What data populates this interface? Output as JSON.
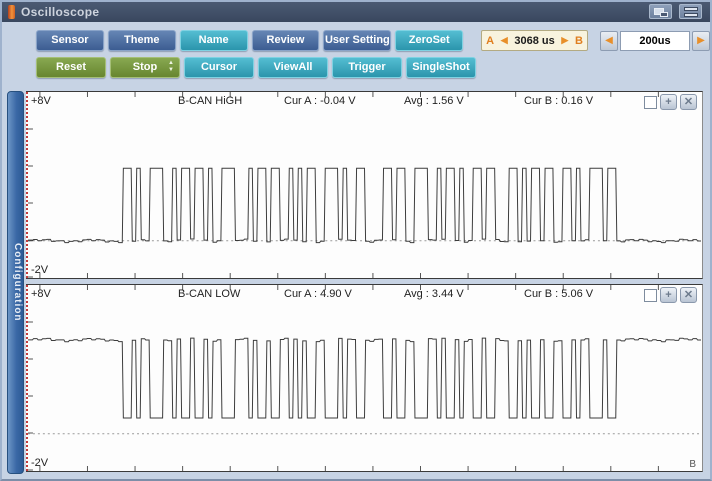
{
  "titlebar": {
    "title": "Oscilloscope",
    "icons": [
      "app-icon",
      "cascade-windows-icon",
      "tile-windows-icon"
    ]
  },
  "icons": {
    "arrow_left": "◀",
    "arrow_right": "▶",
    "spinner_up": "▲",
    "spinner_down": "▼",
    "plus": "+",
    "close": "✕"
  },
  "toolbar": {
    "row1": [
      {
        "label": "Sensor",
        "style": "blue"
      },
      {
        "label": "Theme",
        "style": "blue"
      },
      {
        "label": "Name",
        "style": "teal"
      },
      {
        "label": "Review",
        "style": "blue"
      },
      {
        "label": "User Setting",
        "style": "blue"
      },
      {
        "label": "ZeroSet",
        "style": "teal"
      }
    ],
    "row2": [
      {
        "label": "Reset",
        "style": "green"
      },
      {
        "label": "Stop",
        "style": "green"
      },
      {
        "label": "Cursor",
        "style": "teal"
      },
      {
        "label": "ViewAll",
        "style": "teal"
      },
      {
        "label": "Trigger",
        "style": "teal"
      },
      {
        "label": "SingleShot",
        "style": "teal"
      }
    ],
    "cursor_readout": {
      "a": "A",
      "b": "B",
      "value": "3068 us"
    },
    "timebase": {
      "value": "200us"
    }
  },
  "sidebar": {
    "tab_label": "Configuration"
  },
  "panels": [
    {
      "vmax": "+8V",
      "vmin": "-2V",
      "name": "B-CAN HiGH",
      "cur_a": "Cur A : -0.04 V",
      "avg": "Avg : 1.56 V",
      "cur_b": "Cur B : 0.16 V",
      "corner_label": ""
    },
    {
      "vmax": "+8V",
      "vmin": "-2V",
      "name": "B-CAN LOW",
      "cur_a": "Cur A : 4.90 V",
      "avg": "Avg : 3.44 V",
      "cur_b": "Cur B : 5.06 V",
      "corner_label": "B"
    }
  ],
  "chart_data": [
    {
      "type": "line",
      "title": "B-CAN HiGH",
      "ylabel": "V",
      "ylim": [
        -2,
        8
      ],
      "span_between_cursors": "3068 us",
      "timebase": "200us",
      "levels": {
        "recessive": 0.0,
        "dominant": 3.9
      },
      "cursor_a_v": -0.04,
      "avg_v": 1.56,
      "cursor_b_v": 0.16,
      "zero_dash_v": 0,
      "bits": "000000000000000000000110100111001011011010011100010110110010101100111010011000011011001110010110100110110001101011011001101001110110000000000000000000"
    },
    {
      "type": "line",
      "title": "B-CAN LOW",
      "ylabel": "V",
      "ylim": [
        -2,
        8
      ],
      "span_between_cursors": "3068 us",
      "timebase": "200us",
      "levels": {
        "recessive": 5.05,
        "dominant": 0.85
      },
      "cursor_a_v": 4.9,
      "avg_v": 3.44,
      "cursor_b_v": 5.06,
      "zero_dash_v": 0,
      "bits": "000000000000000000000110100111001011011010011100010110110010101100111010011000011011001110010110100110110001101011011001101001110110000000000000000000"
    }
  ]
}
